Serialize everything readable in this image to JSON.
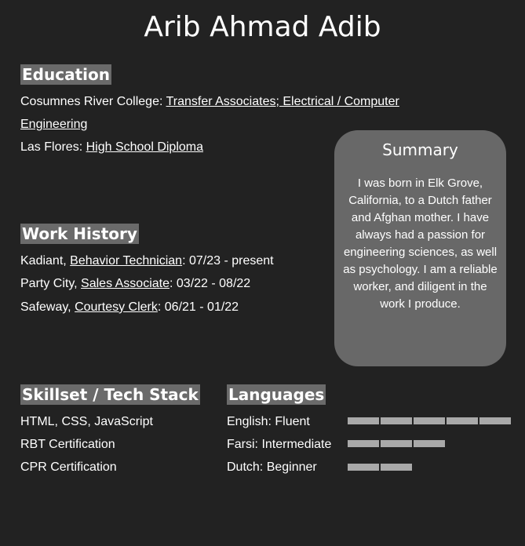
{
  "name": "Arib Ahmad Adib",
  "education": {
    "heading": "Education",
    "items": [
      {
        "school": "Cosumnes River College: ",
        "degree_line1": "Transfer Associates; Electrical / Computer",
        "degree_line2": "Engineering"
      },
      {
        "school": "Las Flores: ",
        "degree": "High School Diploma"
      }
    ]
  },
  "work_history": {
    "heading": "Work History",
    "items": [
      {
        "company": "Kadiant, ",
        "role": "Behavior Technician",
        "dates": ": 07/23 - present"
      },
      {
        "company": "Party City, ",
        "role": "Sales Associate",
        "dates": ": 03/22 - 08/22"
      },
      {
        "company": "Safeway, ",
        "role": "Courtesy Clerk",
        "dates": ": 06/21 - 01/22"
      }
    ]
  },
  "summary": {
    "title": "Summary",
    "text": "I was born in Elk Grove, California, to a Dutch father and Afghan mother. I have always had a passion for engineering sciences, as well as psychology. I am a reliable worker, and diligent in the work I produce."
  },
  "skills": {
    "heading": "Skillset / Tech Stack",
    "items": [
      "HTML, CSS, JavaScript",
      "RBT Certification",
      "CPR Certification"
    ]
  },
  "languages": {
    "heading": "Languages",
    "items": [
      {
        "label": "English: Fluent",
        "level": 5,
        "max": 5
      },
      {
        "label": "Farsi: Intermediate",
        "level": 3,
        "max": 5
      },
      {
        "label": "Dutch: Beginner",
        "level": 2,
        "max": 5
      }
    ]
  },
  "colors": {
    "background": "#222222",
    "heading_bg": "#6a6a6a",
    "summary_bg": "#686868",
    "bar": "#a9a9a9"
  }
}
